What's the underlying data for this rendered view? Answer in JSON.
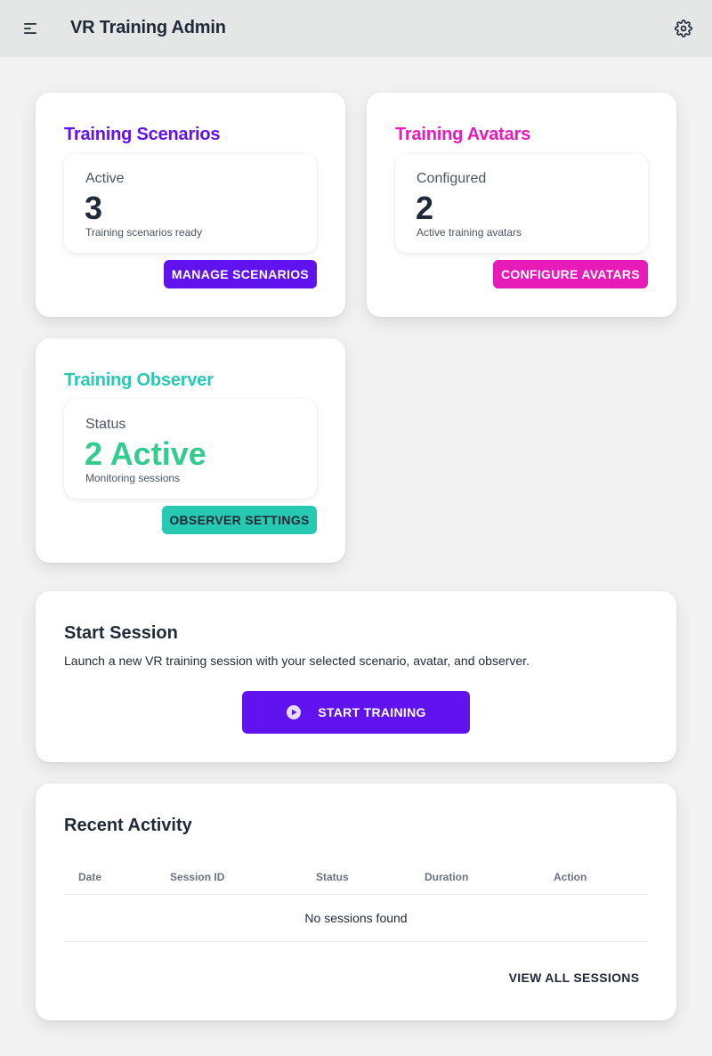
{
  "header": {
    "title": "VR Training Admin",
    "menu_icon": "menu-icon",
    "settings_icon": "gear-icon"
  },
  "colors": {
    "purple": "#6012ef",
    "magenta": "#e81bb8",
    "teal": "#27c9b3",
    "green": "#34cc8e"
  },
  "scenarios": {
    "title": "Training Scenarios",
    "label": "Active",
    "value": "3",
    "desc": "Training scenarios ready",
    "button": "MANAGE SCENARIOS"
  },
  "avatars": {
    "title": "Training Avatars",
    "label": "Configured",
    "value": "2",
    "desc": "Active training avatars",
    "button": "CONFIGURE AVATARS"
  },
  "observer": {
    "title": "Training Observer",
    "label": "Status",
    "value": "2 Active",
    "desc": "Monitoring sessions",
    "button": "OBSERVER SETTINGS"
  },
  "session": {
    "title": "Start Session",
    "desc": "Launch a new VR training session with your selected scenario, avatar, and observer.",
    "button": "START TRAINING",
    "button_icon": "play-circle-icon"
  },
  "activity": {
    "title": "Recent Activity",
    "columns": [
      "Date",
      "Session ID",
      "Status",
      "Duration",
      "Action"
    ],
    "empty": "No sessions found",
    "view_all": "VIEW ALL SESSIONS"
  }
}
